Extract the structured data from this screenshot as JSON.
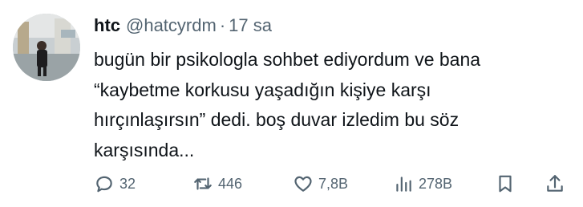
{
  "tweet": {
    "display_name": "htc",
    "handle": "@hatcyrdm",
    "separator": "·",
    "time": "17 sa",
    "text_lines": [
      "bugün bir psikologla sohbet ediyordum ve bana",
      "“kaybetme korkusu yaşadığın kişiye karşı",
      "hırçınlaşırsın” dedi. boş duvar izledim bu söz",
      "karşısında..."
    ]
  },
  "actions": {
    "reply": {
      "icon": "reply-icon",
      "count": "32"
    },
    "retweet": {
      "icon": "retweet-icon",
      "count": "446"
    },
    "like": {
      "icon": "heart-icon",
      "count": "7,8B"
    },
    "views": {
      "icon": "views-icon",
      "count": "278B"
    },
    "bookmark": {
      "icon": "bookmark-icon"
    },
    "share": {
      "icon": "share-icon"
    }
  },
  "colors": {
    "text_primary": "#0f1419",
    "text_secondary": "#536471",
    "background": "#ffffff"
  }
}
